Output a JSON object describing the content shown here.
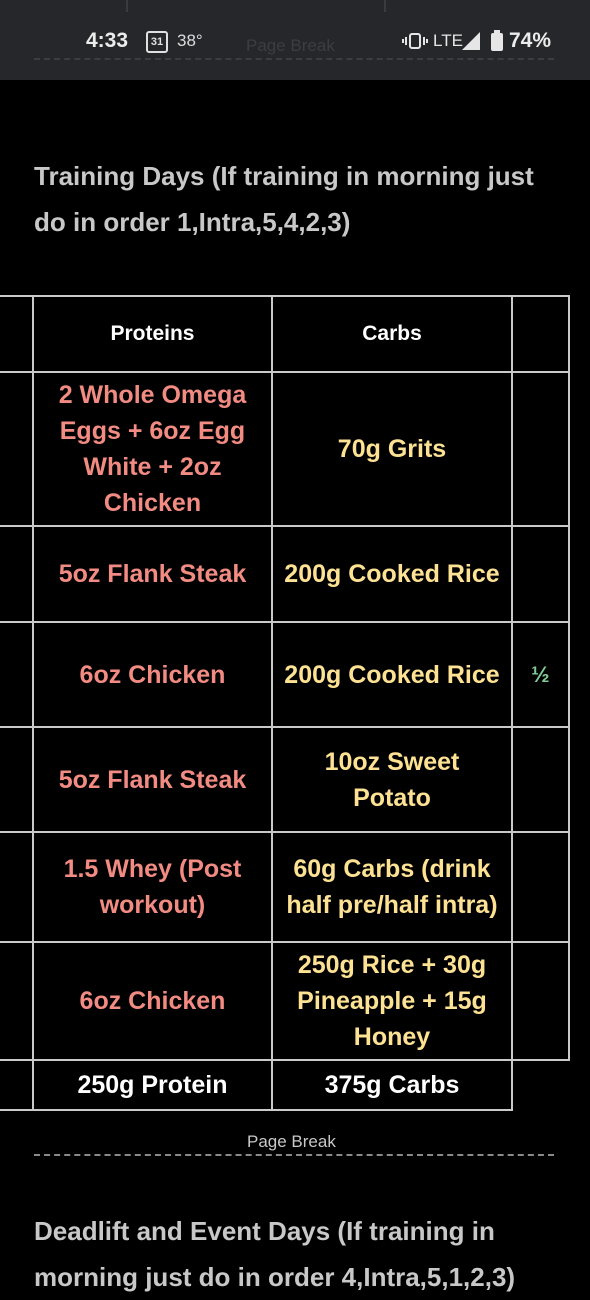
{
  "status_bar": {
    "time": "4:33",
    "calendar_day": "31",
    "temperature": "38°",
    "network": "LTE",
    "battery": "74%",
    "ghost_page_break": "Page Break"
  },
  "training_heading": "Training Days (If training in morning just do in order 1,Intra,5,4,2,3)",
  "table": {
    "headers": {
      "proteins": "Proteins",
      "carbs": "Carbs"
    },
    "rows": [
      {
        "protein": "2 Whole Omega Eggs + 6oz Egg White + 2oz Chicken",
        "carbs": "70g Grits",
        "fat_peek": ""
      },
      {
        "protein": "5oz Flank Steak",
        "carbs": "200g Cooked Rice",
        "fat_peek": ""
      },
      {
        "protein": "6oz Chicken",
        "carbs": "200g Cooked Rice",
        "fat_peek": "½"
      },
      {
        "protein": "5oz Flank Steak",
        "carbs": "10oz Sweet Potato",
        "fat_peek": ""
      },
      {
        "protein": "1.5 Whey (Post workout)",
        "carbs": "60g Carbs (drink half pre/half intra)",
        "fat_peek": ""
      },
      {
        "protein": "6oz Chicken",
        "carbs": "250g Rice + 30g Pineapple + 15g Honey",
        "fat_peek": ""
      }
    ],
    "totals": {
      "protein": "250g Protein",
      "carbs": "375g Carbs"
    }
  },
  "page_break": "Page Break",
  "deadlift_heading": "Deadlift and Event Days (If training in morning just do in order 4,Intra,5,1,2,3)",
  "colors": {
    "protein_text": "#f28b82",
    "carb_text": "#fde293",
    "fat_text": "#81c995",
    "border": "#c9c9c9",
    "background": "#000000",
    "status_bar_bg": "#26272b"
  }
}
